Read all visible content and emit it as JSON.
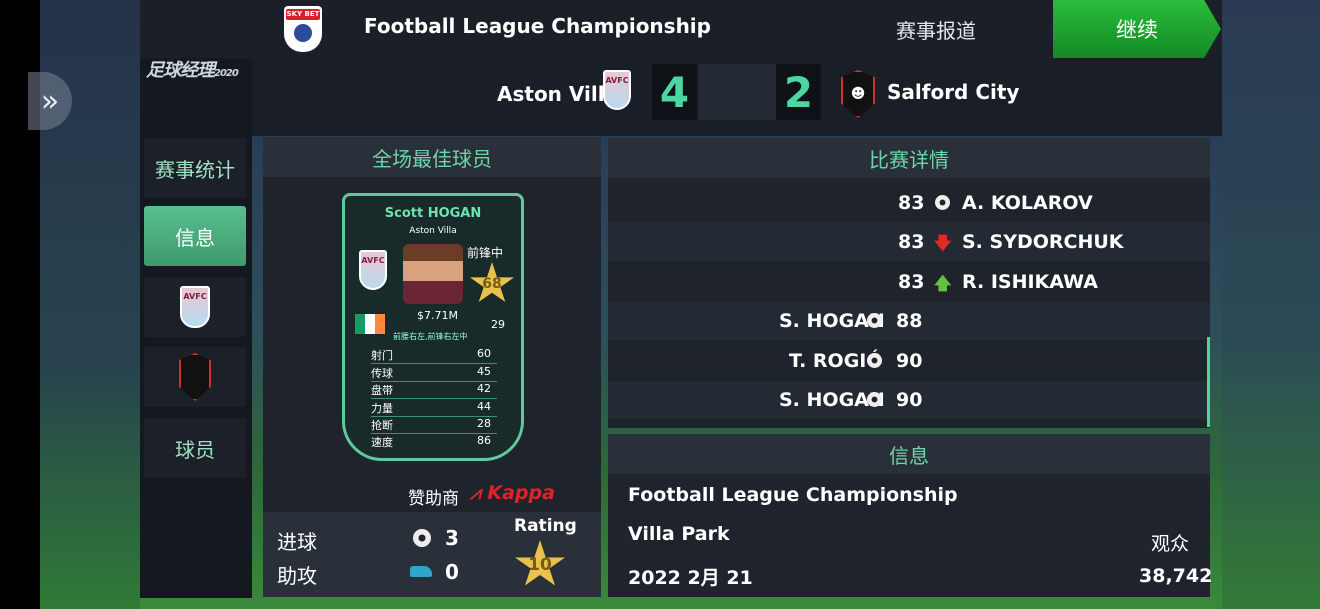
{
  "header": {
    "league_title": "Football League Championship",
    "league_badge": "SKY BET",
    "report_label": "赛事报道",
    "continue_label": "继续"
  },
  "game_logo": {
    "text": "足球经理",
    "year": "2020"
  },
  "sidebar": {
    "items": [
      {
        "label": "赛事统计"
      },
      {
        "label": "信息"
      },
      {
        "label": ""
      },
      {
        "label": ""
      },
      {
        "label": "球员"
      }
    ]
  },
  "match": {
    "home": "Aston Villa",
    "away": "Salford City",
    "home_score": "4",
    "away_score": "2",
    "home_crest_text": "AVFC"
  },
  "best_player": {
    "panel_title": "全场最佳球员",
    "name": "Scott HOGAN",
    "club": "Aston Villa",
    "position": "前锋中",
    "overall": "68",
    "value": "$7.71M",
    "age": "29",
    "roles": "前腰右左,前锋右左中",
    "stats": [
      {
        "label": "射门",
        "value": "60"
      },
      {
        "label": "传球",
        "value": "45"
      },
      {
        "label": "盘带",
        "value": "42"
      },
      {
        "label": "力量",
        "value": "44"
      },
      {
        "label": "抢断",
        "value": "28"
      },
      {
        "label": "速度",
        "value": "86"
      }
    ],
    "sponsor_label": "赞助商",
    "sponsor": "Kappa",
    "goals_label": "进球",
    "goals": "3",
    "assists_label": "助攻",
    "assists": "0",
    "rating_label": "Rating",
    "rating": "10"
  },
  "details": {
    "title": "比赛详情",
    "events": [
      {
        "minute": "83",
        "player": "A. KOLAROV",
        "side": "away",
        "icon": "ball-icon"
      },
      {
        "minute": "83",
        "player": "S. SYDORCHUK",
        "side": "away",
        "icon": "sub-out-arrow-icon"
      },
      {
        "minute": "83",
        "player": "R. ISHIKAWA",
        "side": "away",
        "icon": "sub-in-arrow-icon"
      },
      {
        "minute": "88",
        "player": "S. HOGAN",
        "side": "home",
        "icon": "ball-icon"
      },
      {
        "minute": "90",
        "player": "T. ROGIĆ",
        "side": "home",
        "icon": "ball-icon"
      },
      {
        "minute": "90",
        "player": "S. HOGAN",
        "side": "home",
        "icon": "ball-icon"
      }
    ]
  },
  "info": {
    "title": "信息",
    "competition": "Football League Championship",
    "stadium": "Villa Park",
    "date": "2022 2月 21",
    "attendance_label": "观众",
    "attendance": "38,742"
  },
  "colors": {
    "accent": "#4cd6a0",
    "continue": "#1fa631",
    "card_border": "#5fc9a1",
    "sponsor": "#e0222a",
    "star": "#e8c24a"
  }
}
